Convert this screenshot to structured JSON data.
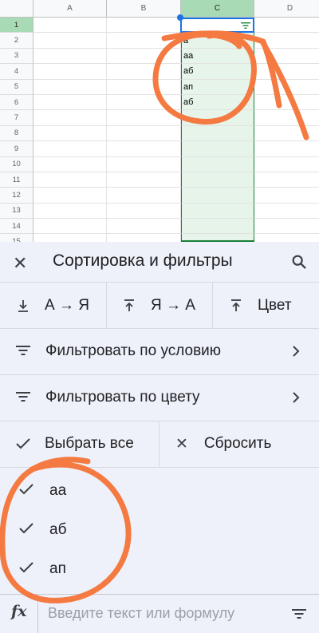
{
  "sheet": {
    "columns": [
      "A",
      "B",
      "C",
      "D"
    ],
    "rows": [
      "1",
      "2",
      "3",
      "4",
      "5",
      "6",
      "7",
      "8",
      "9",
      "10",
      "11",
      "12",
      "13",
      "14",
      "15"
    ],
    "col_c_values": [
      "",
      "a",
      "aa",
      "аб",
      "ап",
      "аб",
      "",
      "",
      "",
      "",
      "",
      "",
      "",
      "",
      ""
    ]
  },
  "panel": {
    "title": "Сортировка и фильтры",
    "sort_az": "А → Я",
    "sort_za": "Я → А",
    "sort_color": "Цвет",
    "filter_condition": "Фильтровать по условию",
    "filter_color": "Фильтровать по цвету",
    "select_all": "Выбрать все",
    "reset": "Сбросить",
    "values": [
      "аа",
      "аб",
      "ап"
    ]
  },
  "formula_bar": {
    "placeholder": "Введите текст или формулу",
    "fx": "fx"
  },
  "colors": {
    "accent_green": "#188038",
    "header_highlight": "#a8dab5",
    "selection_blue": "#1a73e8",
    "annotation_orange": "#f47a42",
    "panel_bg": "#eef1f9"
  },
  "icons": {
    "close": "close-icon",
    "search": "search-icon",
    "sort_asc": "sort-asc-icon",
    "sort_desc": "sort-desc-icon",
    "filter": "filter-icon",
    "chevron": "chevron-right-icon",
    "check": "check-icon",
    "clear": "close-icon",
    "fx": "fx-icon"
  }
}
